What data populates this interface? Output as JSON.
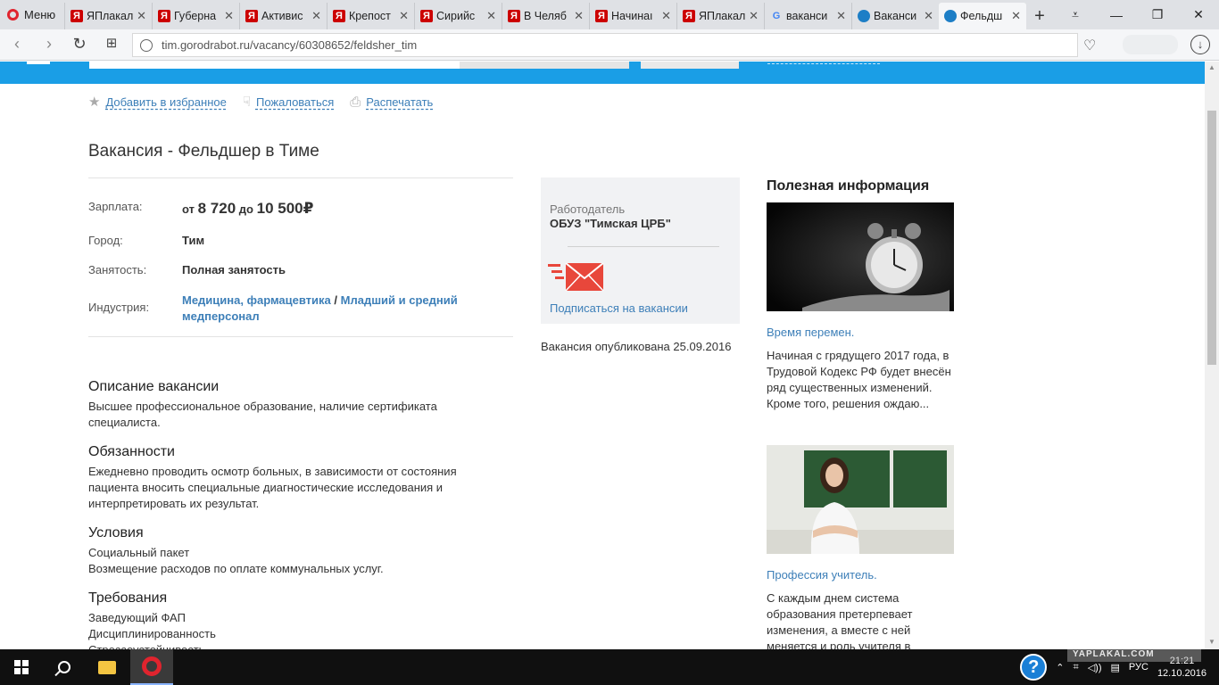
{
  "browser": {
    "menu_label": "Меню",
    "tabs": [
      {
        "label": "ЯПлакал",
        "favicon": "yaplakal-icon"
      },
      {
        "label": "Губерна",
        "favicon": "yaplakal-icon"
      },
      {
        "label": "Активис",
        "favicon": "yaplakal-icon"
      },
      {
        "label": "Крепост",
        "favicon": "yaplakal-icon"
      },
      {
        "label": "Сирийс",
        "favicon": "yaplakal-icon"
      },
      {
        "label": "В Челяб",
        "favicon": "yaplakal-icon"
      },
      {
        "label": "Начинаı",
        "favicon": "yaplakal-icon"
      },
      {
        "label": "ЯПлакал",
        "favicon": "yaplakal-icon"
      },
      {
        "label": "ваканси",
        "favicon": "google-icon"
      },
      {
        "label": "Ваканси",
        "favicon": "gorodrabot-icon"
      },
      {
        "label": "Фельдш",
        "favicon": "gorodrabot-icon",
        "active": true
      }
    ],
    "url": "tim.gorodrabot.ru/vacancy/60308652/feldsher_tim"
  },
  "actions": {
    "favorite": "Добавить в избранное",
    "complain": "Пожаловаться",
    "print": "Распечатать"
  },
  "vacancy": {
    "title": "Вакансия - Фельдшер в Тиме",
    "salary_label": "Зарплата:",
    "salary_from_word": "от",
    "salary_from": "8 720",
    "salary_to_word": "до",
    "salary_to": "10 500₽",
    "city_label": "Город:",
    "city": "Тим",
    "employment_label": "Занятость:",
    "employment": "Полная занятость",
    "industry_label": "Индустрия:",
    "industry_1": "Медицина, фармацевтика",
    "industry_sep": " / ",
    "industry_2": "Младший и средний медперсонал"
  },
  "sections": {
    "description_h": "Описание вакансии",
    "description_t": "Высшее профессиональное образование, наличие сертификата специалиста.",
    "duties_h": "Обязанности",
    "duties_t": "Ежедневно проводить осмотр больных, в зависимости от состояния пациента вносить специальные диагностические исследования и интерпретировать их результат.",
    "conditions_h": "Условия",
    "conditions_t1": "Социальный пакет",
    "conditions_t2": "Возмещение расходов по оплате коммунальных услуг.",
    "requirements_h": "Требования",
    "requirements_t1": "Заведующий ФАП",
    "requirements_t2": "Дисциплинированность",
    "requirements_t3": "Стрессоустойчивость"
  },
  "employer": {
    "label": "Работодатель",
    "name": "ОБУЗ \"Тимская ЦРБ\"",
    "subscribe": "Подписаться на вакансии",
    "published": "Вакансия опубликована 25.09.2016"
  },
  "useful": {
    "heading": "Полезная информация",
    "article1_link": "Время перемен.",
    "article1_text": "Начиная с грядущего 2017 года, в Трудовой Кодекс РФ будет внесён ряд существенных изменений. Кроме того, решения ождаю...",
    "article2_link": "Профессия учитель.",
    "article2_text": "С каждым днем система образования претерпевает изменения, а вместе с ней меняется и роль учителя в"
  },
  "taskbar": {
    "lang": "РУС",
    "time": "21:21",
    "date": "12.10.2016",
    "watermark": "YAPLAKAL.COM"
  },
  "colors": {
    "brand_blue": "#1a9ee6",
    "link_blue": "#3d7fb8",
    "opera_red": "#e0242e"
  }
}
